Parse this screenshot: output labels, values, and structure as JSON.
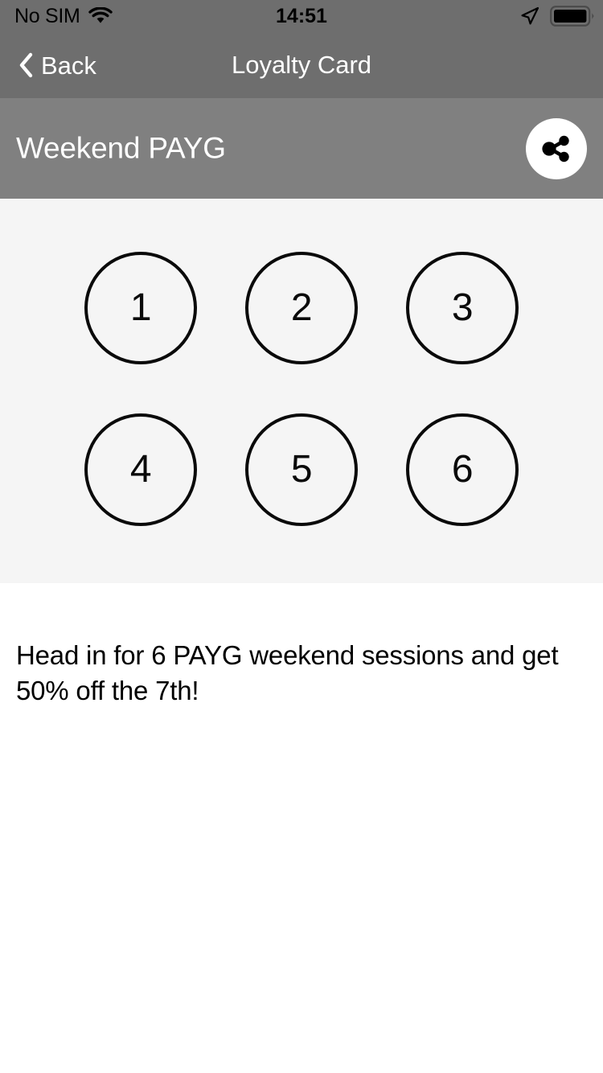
{
  "status_bar": {
    "carrier": "No SIM",
    "time": "14:51",
    "wifi_icon": "wifi-icon",
    "location_icon": "location-arrow-icon",
    "battery_icon": "battery-full-icon"
  },
  "nav_bar": {
    "back_label": "Back",
    "back_icon": "chevron-left-icon",
    "title": "Loyalty Card"
  },
  "header": {
    "card_name": "Weekend PAYG",
    "share_icon": "share-icon"
  },
  "stamps": {
    "rows": [
      [
        {
          "label": "1"
        },
        {
          "label": "2"
        },
        {
          "label": "3"
        }
      ],
      [
        {
          "label": "4"
        },
        {
          "label": "5"
        },
        {
          "label": "6"
        }
      ]
    ]
  },
  "description": {
    "text": "Head in for 6 PAYG weekend sessions and get 50% off the 7th!"
  },
  "colors": {
    "status_bar_bg": "#6e6e6e",
    "nav_bar_bg": "#6e6e6e",
    "header_bg": "#808080",
    "stamps_bg": "#f5f5f5",
    "page_bg": "#ffffff",
    "stamp_stroke": "#0a0a0a",
    "nav_text": "#ffffff",
    "body_text": "#000000"
  }
}
